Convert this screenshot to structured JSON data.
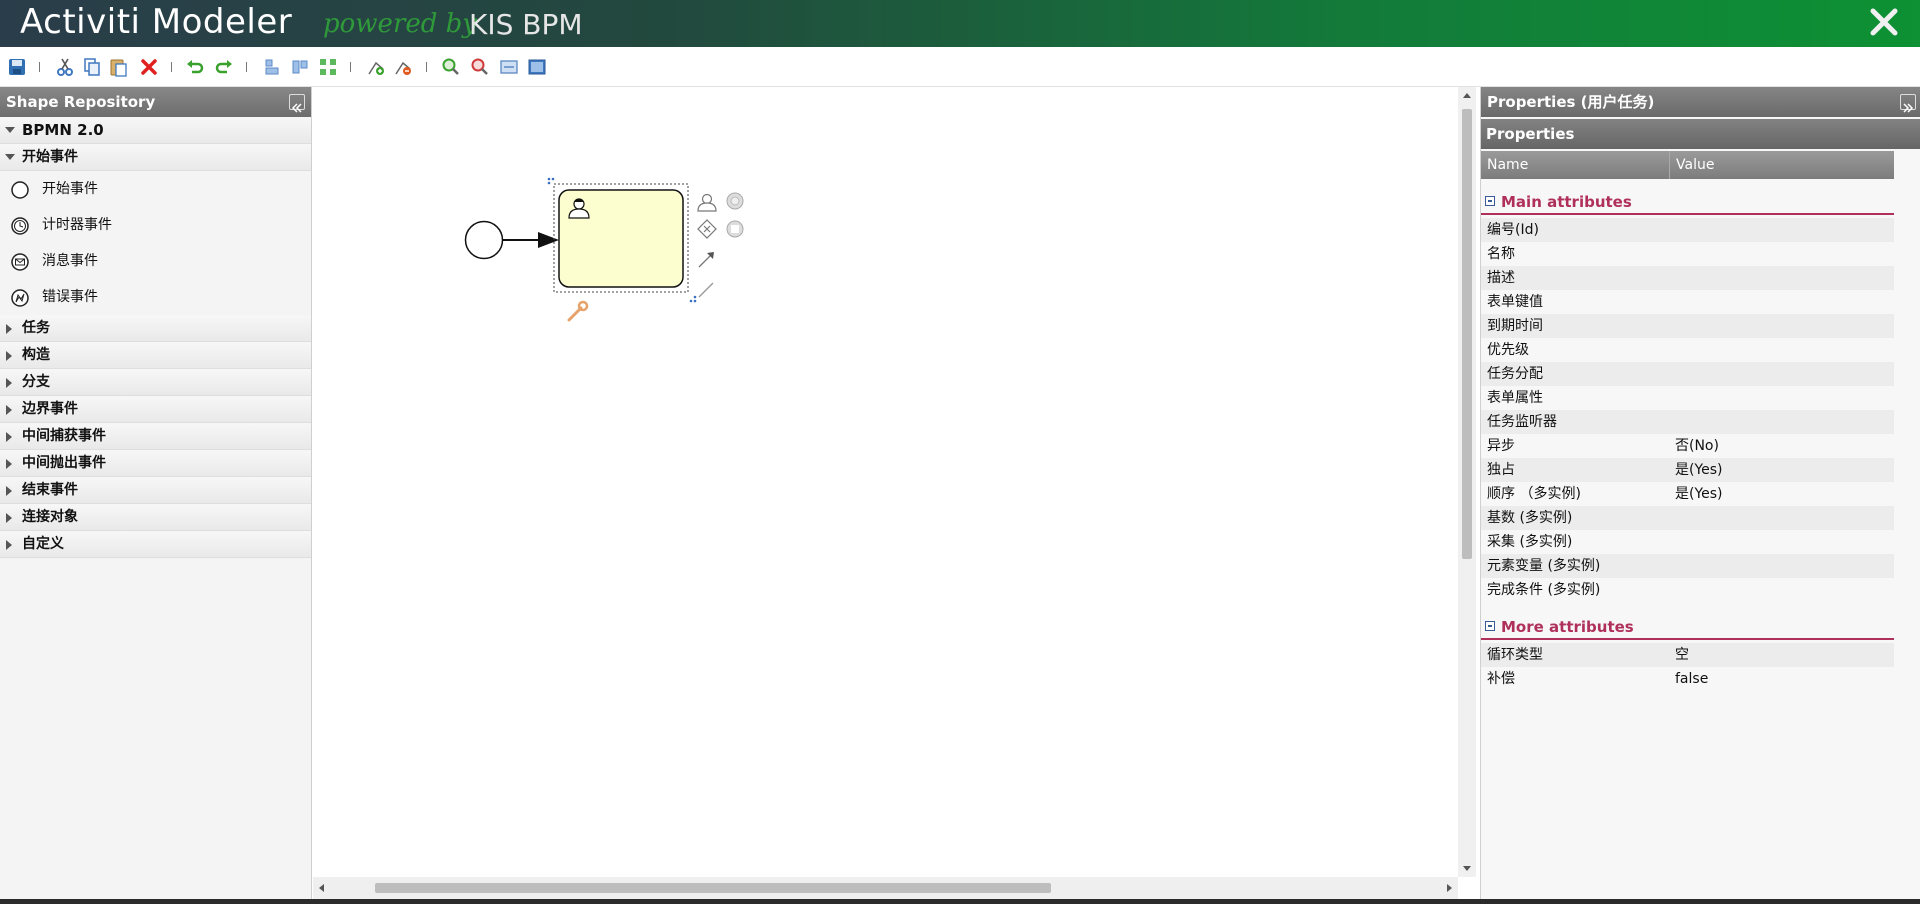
{
  "header": {
    "title": "Activiti Modeler",
    "powered": "powered by",
    "brand": "KIS BPM"
  },
  "toolbar": {
    "items": [
      "save-icon",
      "cut-icon",
      "copy-icon",
      "paste-icon",
      "delete-icon",
      "undo-icon",
      "redo-icon",
      "align-vertical-icon",
      "align-horizontal-icon",
      "align-size-icon",
      "add-bendpoint-icon",
      "remove-bendpoint-icon",
      "zoom-in-icon",
      "zoom-out-icon",
      "zoom-actual-icon",
      "zoom-fit-icon"
    ]
  },
  "shape_repository": {
    "title": "Shape Repository",
    "root": "BPMN 2.0",
    "open_category": "开始事件",
    "items": [
      "开始事件",
      "计时器事件",
      "消息事件",
      "错误事件"
    ],
    "categories": [
      "任务",
      "构造",
      "分支",
      "边界事件",
      "中间捕获事件",
      "中间抛出事件",
      "结束事件",
      "连接对象",
      "自定义"
    ]
  },
  "properties": {
    "title": "Properties (用户任务)",
    "subtitle": "Properties",
    "col_name": "Name",
    "col_value": "Value",
    "main_group": "Main attributes",
    "main_rows": [
      {
        "name": "编号(Id)",
        "value": ""
      },
      {
        "name": "名称",
        "value": ""
      },
      {
        "name": "描述",
        "value": ""
      },
      {
        "name": "表单键值",
        "value": ""
      },
      {
        "name": "到期时间",
        "value": ""
      },
      {
        "name": "优先级",
        "value": ""
      },
      {
        "name": "任务分配",
        "value": ""
      },
      {
        "name": "表单属性",
        "value": ""
      },
      {
        "name": "任务监听器",
        "value": ""
      },
      {
        "name": "异步",
        "value": "否(No)"
      },
      {
        "name": "独占",
        "value": "是(Yes)"
      },
      {
        "name": "顺序 （多实例)",
        "value": "是(Yes)"
      },
      {
        "name": "基数 (多实例)",
        "value": ""
      },
      {
        "name": "采集 (多实例)",
        "value": ""
      },
      {
        "name": "元素变量 (多实例)",
        "value": ""
      },
      {
        "name": "完成条件 (多实例)",
        "value": ""
      }
    ],
    "more_group": "More attributes",
    "more_rows": [
      {
        "name": "循环类型",
        "value": "空"
      },
      {
        "name": "补偿",
        "value": "false"
      }
    ]
  },
  "colors": {
    "accent": "#b0305c",
    "task_fill": "#fdfed0",
    "header_green": "#0d9134"
  }
}
